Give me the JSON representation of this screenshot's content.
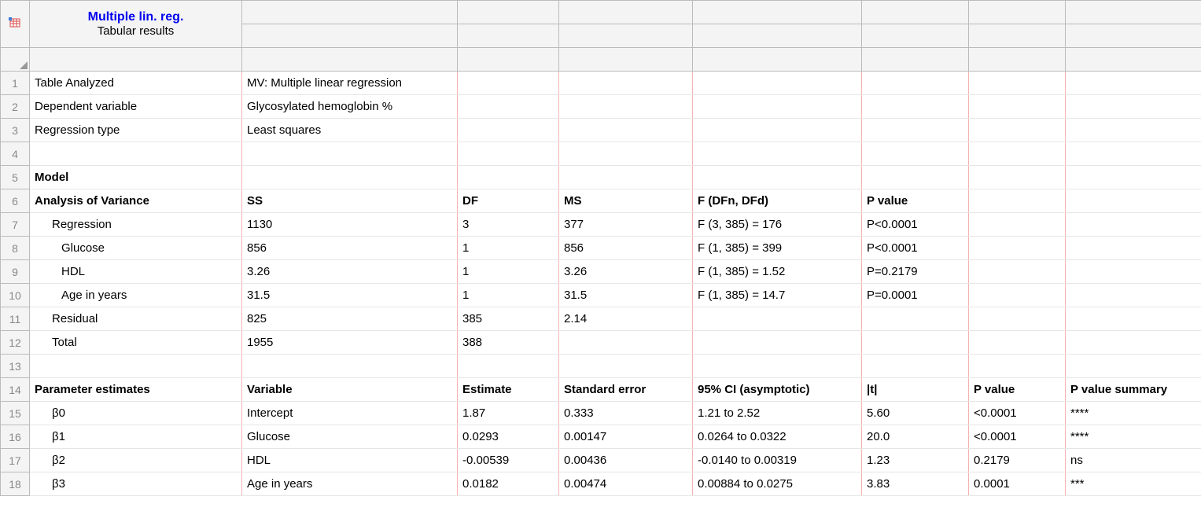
{
  "header": {
    "title": "Multiple lin. reg.",
    "subtitle": "Tabular results"
  },
  "rows": [
    {
      "num": "1",
      "cells": [
        "Table Analyzed",
        "MV: Multiple linear regression",
        "",
        "",
        "",
        "",
        "",
        ""
      ]
    },
    {
      "num": "2",
      "cells": [
        "Dependent variable",
        "Glycosylated hemoglobin %",
        "",
        "",
        "",
        "",
        "",
        ""
      ]
    },
    {
      "num": "3",
      "cells": [
        "Regression type",
        "Least squares",
        "",
        "",
        "",
        "",
        "",
        ""
      ]
    },
    {
      "num": "4",
      "cells": [
        "",
        "",
        "",
        "",
        "",
        "",
        "",
        ""
      ]
    },
    {
      "num": "5",
      "cells": [
        "Model",
        "",
        "",
        "",
        "",
        "",
        "",
        ""
      ],
      "bold": [
        0
      ]
    },
    {
      "num": "6",
      "cells": [
        "Analysis of Variance",
        "SS",
        "DF",
        "MS",
        "F (DFn, DFd)",
        "P value",
        "",
        ""
      ],
      "bold": [
        0,
        1,
        2,
        3,
        4,
        5
      ]
    },
    {
      "num": "7",
      "cells": [
        "Regression",
        "1130",
        "3",
        "377",
        "F (3, 385) = 176",
        "P<0.0001",
        "",
        ""
      ],
      "indent0": 1
    },
    {
      "num": "8",
      "cells": [
        "Glucose",
        "856",
        "1",
        "856",
        "F (1, 385) = 399",
        "P<0.0001",
        "",
        ""
      ],
      "indent0": 2
    },
    {
      "num": "9",
      "cells": [
        "HDL",
        "3.26",
        "1",
        "3.26",
        "F (1, 385) = 1.52",
        "P=0.2179",
        "",
        ""
      ],
      "indent0": 2
    },
    {
      "num": "10",
      "cells": [
        "Age in years",
        "31.5",
        "1",
        "31.5",
        "F (1, 385) = 14.7",
        "P=0.0001",
        "",
        ""
      ],
      "indent0": 2
    },
    {
      "num": "11",
      "cells": [
        "Residual",
        "825",
        "385",
        "2.14",
        "",
        "",
        "",
        ""
      ],
      "indent0": 1
    },
    {
      "num": "12",
      "cells": [
        "Total",
        "1955",
        "388",
        "",
        "",
        "",
        "",
        ""
      ],
      "indent0": 1
    },
    {
      "num": "13",
      "cells": [
        "",
        "",
        "",
        "",
        "",
        "",
        "",
        ""
      ]
    },
    {
      "num": "14",
      "cells": [
        "Parameter estimates",
        "Variable",
        "Estimate",
        "Standard error",
        "95% CI (asymptotic)",
        "|t|",
        "P value",
        "P value summary"
      ],
      "bold": [
        0,
        1,
        2,
        3,
        4,
        5,
        6,
        7
      ]
    },
    {
      "num": "15",
      "cells": [
        "β0",
        "Intercept",
        "1.87",
        "0.333",
        "1.21 to 2.52",
        "5.60",
        "<0.0001",
        "****"
      ],
      "indent0": 1
    },
    {
      "num": "16",
      "cells": [
        "β1",
        "Glucose",
        "0.0293",
        "0.00147",
        "0.0264 to 0.0322",
        "20.0",
        "<0.0001",
        "****"
      ],
      "indent0": 1
    },
    {
      "num": "17",
      "cells": [
        "β2",
        "HDL",
        "-0.00539",
        "0.00436",
        "-0.0140 to 0.00319",
        "1.23",
        "0.2179",
        "ns"
      ],
      "indent0": 1
    },
    {
      "num": "18",
      "cells": [
        "β3",
        "Age in years",
        "0.0182",
        "0.00474",
        "0.00884 to 0.0275",
        "3.83",
        "0.0001",
        "***"
      ],
      "indent0": 1
    }
  ]
}
